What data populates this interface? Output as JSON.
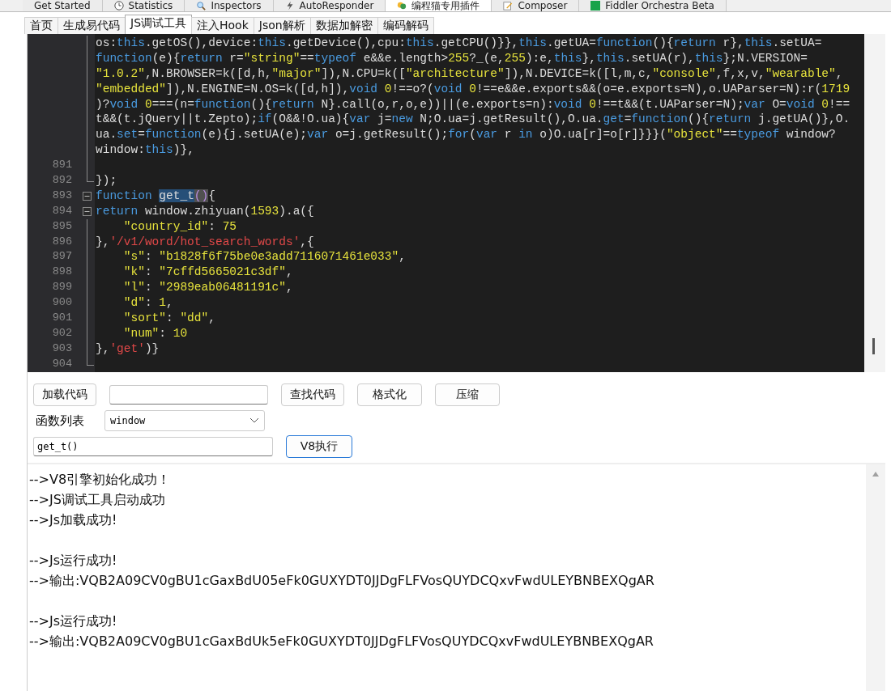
{
  "host_tabs": [
    {
      "label": "Get Started",
      "selected": false
    },
    {
      "label": "Statistics",
      "selected": false
    },
    {
      "label": "Inspectors",
      "selected": false
    },
    {
      "label": "AutoResponder",
      "selected": false
    },
    {
      "label": "编程猫专用插件",
      "selected": true
    },
    {
      "label": "Composer",
      "selected": false
    },
    {
      "label": "Fiddler Orchestra Beta",
      "selected": false
    }
  ],
  "tool_tabs": [
    {
      "label": "首页",
      "selected": false
    },
    {
      "label": "生成易代码",
      "selected": false
    },
    {
      "label": "JS调试工具",
      "selected": true
    },
    {
      "label": "注入Hook",
      "selected": false
    },
    {
      "label": "Json解析",
      "selected": false
    },
    {
      "label": "数据加解密",
      "selected": false
    },
    {
      "label": "编码解码",
      "selected": false
    }
  ],
  "editor": {
    "lines": [
      {
        "kind": "guide",
        "tokens": [
          {
            "kind": "plain",
            "text": "os:"
          },
          {
            "kind": "keyword",
            "text": "this"
          },
          {
            "kind": "plain",
            "text": ".getOS(),device:"
          },
          {
            "kind": "keyword",
            "text": "this"
          },
          {
            "kind": "plain",
            "text": ".getDevice(),cpu:"
          },
          {
            "kind": "keyword",
            "text": "this"
          },
          {
            "kind": "plain",
            "text": ".getCPU()}},"
          },
          {
            "kind": "keyword",
            "text": "this"
          },
          {
            "kind": "plain",
            "text": ".getUA="
          },
          {
            "kind": "keyword",
            "text": "function"
          },
          {
            "kind": "plain",
            "text": "(){"
          },
          {
            "kind": "keyword",
            "text": "return"
          },
          {
            "kind": "plain",
            "text": " r},"
          },
          {
            "kind": "keyword",
            "text": "this"
          },
          {
            "kind": "plain",
            "text": ".setUA="
          }
        ]
      },
      {
        "kind": "guide",
        "tokens": [
          {
            "kind": "keyword",
            "text": "function"
          },
          {
            "kind": "plain",
            "text": "(e){"
          },
          {
            "kind": "keyword",
            "text": "return"
          },
          {
            "kind": "plain",
            "text": " r="
          },
          {
            "kind": "string",
            "text": "\"string\""
          },
          {
            "kind": "plain",
            "text": "=="
          },
          {
            "kind": "keyword",
            "text": "typeof"
          },
          {
            "kind": "plain",
            "text": " e&&e.length>"
          },
          {
            "kind": "number",
            "text": "255"
          },
          {
            "kind": "plain",
            "text": "?_(e,"
          },
          {
            "kind": "number",
            "text": "255"
          },
          {
            "kind": "plain",
            "text": "):e,"
          },
          {
            "kind": "keyword",
            "text": "this"
          },
          {
            "kind": "plain",
            "text": "},"
          },
          {
            "kind": "keyword",
            "text": "this"
          },
          {
            "kind": "plain",
            "text": ".setUA(r),"
          },
          {
            "kind": "keyword",
            "text": "this"
          },
          {
            "kind": "plain",
            "text": "};N.VERSION="
          }
        ]
      },
      {
        "kind": "guide",
        "tokens": [
          {
            "kind": "string",
            "text": "\"1.0.2\""
          },
          {
            "kind": "plain",
            "text": ",N.BROWSER=k([d,h,"
          },
          {
            "kind": "string",
            "text": "\"major\""
          },
          {
            "kind": "plain",
            "text": "]),N.CPU=k(["
          },
          {
            "kind": "string",
            "text": "\"architecture\""
          },
          {
            "kind": "plain",
            "text": "]),N.DEVICE=k([l,m,c,"
          },
          {
            "kind": "string",
            "text": "\"console\""
          },
          {
            "kind": "plain",
            "text": ",f,x,v,"
          },
          {
            "kind": "string",
            "text": "\"wearable\""
          },
          {
            "kind": "plain",
            "text": ","
          }
        ]
      },
      {
        "kind": "guide",
        "tokens": [
          {
            "kind": "string",
            "text": "\"embedded\""
          },
          {
            "kind": "plain",
            "text": "]),N.ENGINE=N.OS=k([d,h]),"
          },
          {
            "kind": "keyword",
            "text": "void"
          },
          {
            "kind": "number",
            "text": " 0"
          },
          {
            "kind": "plain",
            "text": "!==o?("
          },
          {
            "kind": "keyword",
            "text": "void"
          },
          {
            "kind": "number",
            "text": " 0"
          },
          {
            "kind": "plain",
            "text": "!==e&&e.exports&&(o=e.exports=N),o.UAParser=N):r("
          },
          {
            "kind": "number",
            "text": "1719"
          }
        ]
      },
      {
        "kind": "guide",
        "tokens": [
          {
            "kind": "plain",
            "text": ")?"
          },
          {
            "kind": "keyword",
            "text": "void"
          },
          {
            "kind": "number",
            "text": " 0"
          },
          {
            "kind": "plain",
            "text": "===(n="
          },
          {
            "kind": "keyword",
            "text": "function"
          },
          {
            "kind": "plain",
            "text": "(){"
          },
          {
            "kind": "keyword",
            "text": "return"
          },
          {
            "kind": "plain",
            "text": " N}.call(o,r,o,e))||(e.exports=n):"
          },
          {
            "kind": "keyword",
            "text": "void"
          },
          {
            "kind": "number",
            "text": " 0"
          },
          {
            "kind": "plain",
            "text": "!==t&&(t.UAParser=N);"
          },
          {
            "kind": "keyword",
            "text": "var"
          },
          {
            "kind": "plain",
            "text": " O="
          },
          {
            "kind": "keyword",
            "text": "void"
          },
          {
            "kind": "number",
            "text": " 0"
          },
          {
            "kind": "plain",
            "text": "!=="
          }
        ]
      },
      {
        "kind": "guide",
        "tokens": [
          {
            "kind": "plain",
            "text": "t&&(t.jQuery||t.Zepto);"
          },
          {
            "kind": "keyword",
            "text": "if"
          },
          {
            "kind": "plain",
            "text": "(O&&!O.ua){"
          },
          {
            "kind": "keyword",
            "text": "var"
          },
          {
            "kind": "plain",
            "text": " j="
          },
          {
            "kind": "keyword",
            "text": "new"
          },
          {
            "kind": "plain",
            "text": " N;O.ua=j.getResult(),O.ua."
          },
          {
            "kind": "keyword",
            "text": "get"
          },
          {
            "kind": "plain",
            "text": "="
          },
          {
            "kind": "keyword",
            "text": "function"
          },
          {
            "kind": "plain",
            "text": "(){"
          },
          {
            "kind": "keyword",
            "text": "return"
          },
          {
            "kind": "plain",
            "text": " j.getUA()},O."
          }
        ]
      },
      {
        "kind": "guide",
        "tokens": [
          {
            "kind": "plain",
            "text": "ua."
          },
          {
            "kind": "keyword",
            "text": "set"
          },
          {
            "kind": "plain",
            "text": "="
          },
          {
            "kind": "keyword",
            "text": "function"
          },
          {
            "kind": "plain",
            "text": "(e){j.setUA(e);"
          },
          {
            "kind": "keyword",
            "text": "var"
          },
          {
            "kind": "plain",
            "text": " o=j.getResult();"
          },
          {
            "kind": "keyword",
            "text": "for"
          },
          {
            "kind": "plain",
            "text": "("
          },
          {
            "kind": "keyword",
            "text": "var"
          },
          {
            "kind": "plain",
            "text": " r "
          },
          {
            "kind": "keyword",
            "text": "in"
          },
          {
            "kind": "plain",
            "text": " o)O.ua[r]=o[r]}}}("
          },
          {
            "kind": "string",
            "text": "\"object\""
          },
          {
            "kind": "plain",
            "text": "=="
          },
          {
            "kind": "keyword",
            "text": "typeof"
          },
          {
            "kind": "plain",
            "text": " window?"
          }
        ]
      },
      {
        "kind": "guide",
        "tokens": [
          {
            "kind": "plain",
            "text": "window:"
          },
          {
            "kind": "keyword",
            "text": "this"
          },
          {
            "kind": "plain",
            "text": ")},"
          }
        ]
      },
      {
        "number": "891",
        "kind": "guide"
      },
      {
        "number": "892",
        "kind": "end",
        "tokens": [
          {
            "kind": "plain",
            "text": "});"
          }
        ]
      },
      {
        "number": "893",
        "kind": "fold",
        "tokens": [
          {
            "kind": "keyword",
            "text": "function "
          },
          {
            "kind": "selected",
            "text": "get_t"
          },
          {
            "kind": "bracket",
            "text": "()"
          },
          {
            "kind": "plain",
            "text": "{"
          }
        ]
      },
      {
        "number": "894",
        "kind": "fold",
        "tokens": [
          {
            "kind": "keyword",
            "text": "return"
          },
          {
            "kind": "plain",
            "text": " window.zhiyuan("
          },
          {
            "kind": "number",
            "text": "1593"
          },
          {
            "kind": "plain",
            "text": ").a({"
          }
        ]
      },
      {
        "number": "895",
        "kind": "guide",
        "tokens": [
          {
            "kind": "string",
            "text": "    \"country_id\""
          },
          {
            "kind": "plain",
            "text": ": "
          },
          {
            "kind": "number",
            "text": "75"
          }
        ]
      },
      {
        "number": "896",
        "kind": "guide",
        "tokens": [
          {
            "kind": "plain",
            "text": "},"
          },
          {
            "kind": "literal",
            "text": "'/v1/word/hot_search_words'"
          },
          {
            "kind": "plain",
            "text": ",{"
          }
        ]
      },
      {
        "number": "897",
        "kind": "guide",
        "tokens": [
          {
            "kind": "string",
            "text": "    \"s\""
          },
          {
            "kind": "plain",
            "text": ": "
          },
          {
            "kind": "string",
            "text": "\"b1828f6f75be0e3add7116071461e033\""
          },
          {
            "kind": "plain",
            "text": ","
          }
        ]
      },
      {
        "number": "898",
        "kind": "guide",
        "tokens": [
          {
            "kind": "string",
            "text": "    \"k\""
          },
          {
            "kind": "plain",
            "text": ": "
          },
          {
            "kind": "string",
            "text": "\"7cffd5665021c3df\""
          },
          {
            "kind": "plain",
            "text": ","
          }
        ]
      },
      {
        "number": "899",
        "kind": "guide",
        "tokens": [
          {
            "kind": "string",
            "text": "    \"l\""
          },
          {
            "kind": "plain",
            "text": ": "
          },
          {
            "kind": "string",
            "text": "\"2989eab06481191c\""
          },
          {
            "kind": "plain",
            "text": ","
          }
        ]
      },
      {
        "number": "900",
        "kind": "guide",
        "tokens": [
          {
            "kind": "string",
            "text": "    \"d\""
          },
          {
            "kind": "plain",
            "text": ": "
          },
          {
            "kind": "number",
            "text": "1"
          },
          {
            "kind": "plain",
            "text": ","
          }
        ]
      },
      {
        "number": "901",
        "kind": "guide",
        "tokens": [
          {
            "kind": "string",
            "text": "    \"sort\""
          },
          {
            "kind": "plain",
            "text": ": "
          },
          {
            "kind": "string",
            "text": "\"dd\""
          },
          {
            "kind": "plain",
            "text": ","
          }
        ]
      },
      {
        "number": "902",
        "kind": "guide",
        "tokens": [
          {
            "kind": "string",
            "text": "    \"num\""
          },
          {
            "kind": "plain",
            "text": ": "
          },
          {
            "kind": "number",
            "text": "10"
          }
        ]
      },
      {
        "number": "903",
        "kind": "guide",
        "tokens": [
          {
            "kind": "plain",
            "text": "},"
          },
          {
            "kind": "literal",
            "text": "'get'"
          },
          {
            "kind": "plain",
            "text": ")}"
          }
        ]
      },
      {
        "number": "904",
        "kind": "end"
      }
    ]
  },
  "controls": {
    "load_button": "加载代码",
    "find_button": "查找代码",
    "format_button": "格式化",
    "compress_button": "压缩",
    "function_list_label": "函数列表",
    "function_select": "window",
    "call_field": "get_t()",
    "run_button": "V8执行"
  },
  "output": {
    "blocks": [
      [
        "-->V8引擎初始化成功！",
        "-->JS调试工具启动成功",
        "-->Js加载成功!"
      ],
      [
        "-->Js运行成功!",
        "-->输出:VQB2A09CV0gBU1cGaxBdU05eFk0GUXYDT0JJDgFLFVosQUYDCQxvFwdULEYBNBEXQgAR"
      ],
      [
        "-->Js运行成功!",
        "-->输出:VQB2A09CV0gBU1cGaxBdUk5eFk0GUXYDT0JJDgFLFVosQUYDCQxvFwdULEYBNBEXQgAR"
      ]
    ]
  }
}
